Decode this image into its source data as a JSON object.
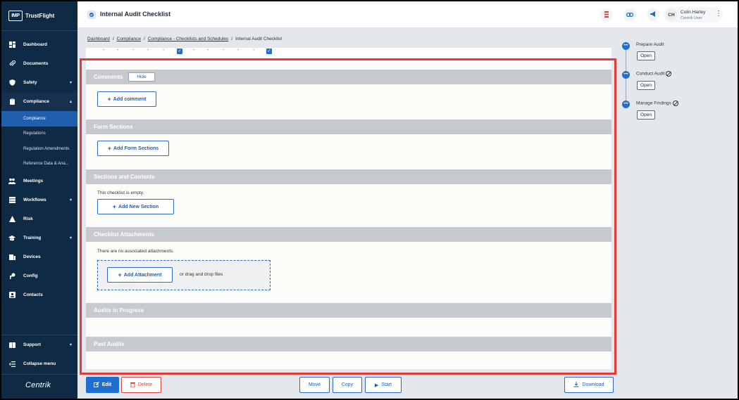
{
  "brand": {
    "logo_text": "IMP",
    "name": "TrustFlight"
  },
  "sidebar": {
    "items": [
      {
        "label": "Dashboard",
        "icon": "dashboard-icon"
      },
      {
        "label": "Documents",
        "icon": "paperclip-icon"
      },
      {
        "label": "Safety",
        "icon": "shield-icon"
      },
      {
        "label": "Compliance",
        "icon": "clipboard-icon"
      }
    ],
    "compliance_sub": [
      "Compliance",
      "Regulations",
      "Regulation Amendments",
      "Reference Data & Ana..."
    ],
    "items_after": [
      {
        "label": "Meetings",
        "icon": "people-icon"
      },
      {
        "label": "Workflows",
        "icon": "layers-icon"
      },
      {
        "label": "Risk",
        "icon": "warning-icon"
      },
      {
        "label": "Training",
        "icon": "graduation-cap-icon"
      },
      {
        "label": "Devices",
        "icon": "device-icon"
      },
      {
        "label": "Config",
        "icon": "key-icon"
      },
      {
        "label": "Contacts",
        "icon": "contacts-icon"
      }
    ],
    "support": "Support",
    "collapse": "Collapse menu",
    "footer_logo": "Centrik"
  },
  "header": {
    "title": "Internal Audit Checklist",
    "user_initials": "CH",
    "user_name": "Colin Harley",
    "user_role": "Centrik User"
  },
  "breadcrumb": [
    "Dashboard",
    "Compliance",
    "Compliance - Checklists and Schedules",
    "Internal Audit Checklist"
  ],
  "sections": {
    "comments": {
      "title": "Comments",
      "hide_label": "Hide",
      "add_label": "Add comment"
    },
    "form_sections": {
      "title": "Form Sections",
      "add_label": "Add Form Sections"
    },
    "sections_contents": {
      "title": "Sections and Contents",
      "empty_text": "This checklist is empty.",
      "add_label": "Add New Section"
    },
    "attachments": {
      "title": "Checklist Attachments",
      "empty_text": "There are no associated attachments.",
      "add_label": "Add Attachment",
      "drop_text": "or drag and drop files"
    },
    "audits_in_progress": {
      "title": "Audits in Progress"
    },
    "past_audits": {
      "title": "Past Audits"
    }
  },
  "timeline": [
    {
      "label": "Prepare Audit",
      "button": "Open",
      "disabled": false
    },
    {
      "label": "Conduct Audit",
      "button": "Open",
      "disabled": true
    },
    {
      "label": "Manage Findings",
      "button": "Open",
      "disabled": true
    }
  ],
  "actions": {
    "edit": "Edit",
    "delete": "Delete",
    "move": "Move",
    "copy": "Copy",
    "start": "Start",
    "download": "Download"
  },
  "colors": {
    "sidebar_bg": "#0f2a44",
    "accent": "#1f6fd1",
    "highlight": "#e53935",
    "section_header": "#c6c9cd"
  }
}
